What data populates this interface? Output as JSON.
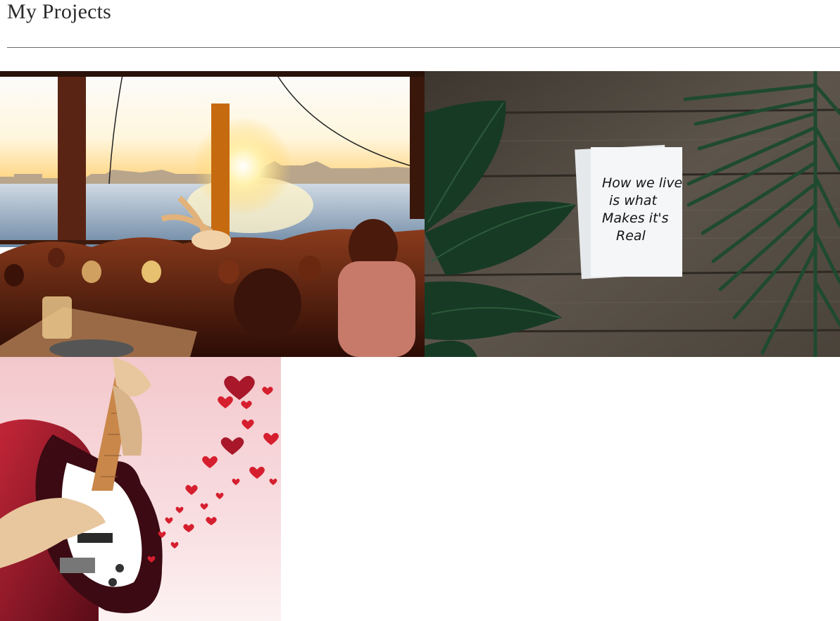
{
  "header": {
    "title": "My Projects"
  },
  "projects": [
    {
      "image_subject": "rooftop bar crowd at sunset by the water",
      "image_text": []
    },
    {
      "image_subject": "white note card on wooden table between green leaves",
      "image_text": [
        "How we live",
        "is what",
        "Makes it's",
        "Real"
      ]
    },
    {
      "image_subject": "illustration of hands playing an electric guitar with floating hearts",
      "image_text": []
    }
  ],
  "colors": {
    "title_text": "#2a2a2a",
    "divider": "#6b6b6b",
    "background": "#ffffff"
  }
}
